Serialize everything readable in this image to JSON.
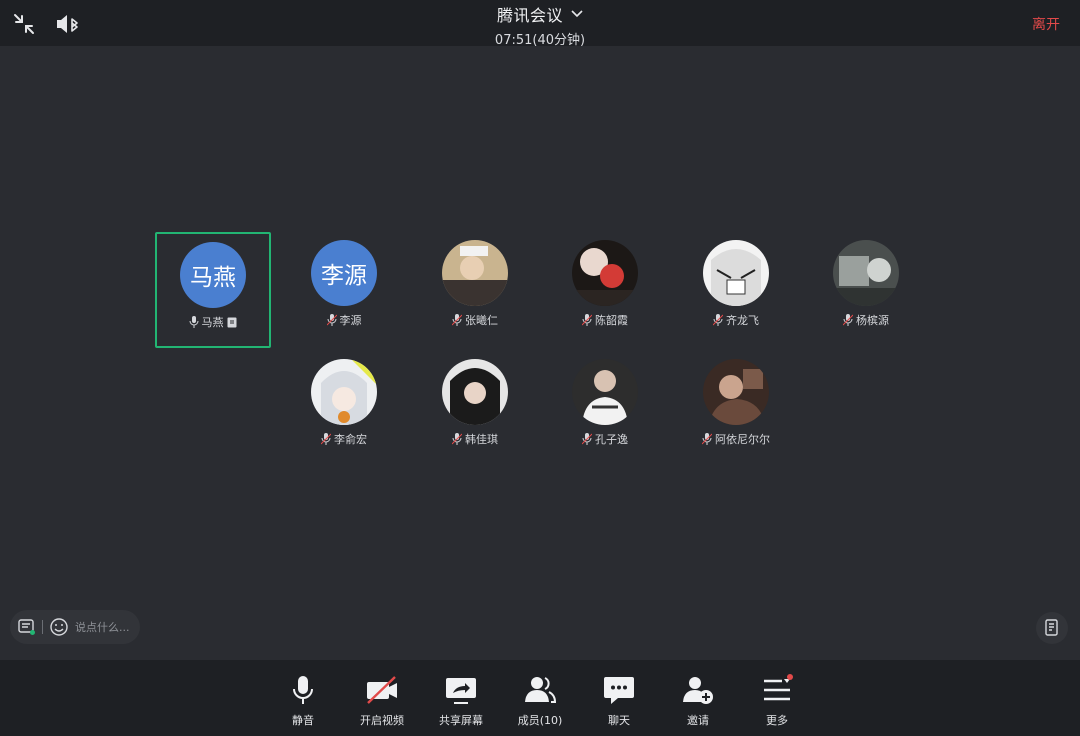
{
  "header": {
    "meeting_title": "腾讯会议",
    "meeting_time": "07:51(40分钟)",
    "leave_label": "离开"
  },
  "participants_row1": [
    {
      "name": "马燕",
      "avatar_text": "马燕",
      "avatar_color": "#4a7fd0",
      "active": true
    },
    {
      "name": "李源",
      "avatar_text": "李源",
      "avatar_color": "#4a7fd0"
    },
    {
      "name": "张曦仁"
    },
    {
      "name": "陈韶霞"
    },
    {
      "name": "齐龙飞"
    },
    {
      "name": "杨槟源"
    }
  ],
  "participants_row2": [
    {
      "name": "李俞宏"
    },
    {
      "name": "韩佳琪"
    },
    {
      "name": "孔子逸"
    },
    {
      "name": "阿依尼尔尔"
    }
  ],
  "chat": {
    "placeholder": "说点什么..."
  },
  "toolbar": {
    "mute_label": "静音",
    "video_label": "开启视频",
    "share_label": "共享屏幕",
    "members_label": "成员(10)",
    "chat_label": "聊天",
    "invite_label": "邀请",
    "more_label": "更多"
  },
  "colors": {
    "background": "#2a2c31",
    "bar": "#1e2024",
    "accent_active": "#22b573",
    "leave": "#e24a4a",
    "avatar_blue": "#4a7fd0"
  }
}
